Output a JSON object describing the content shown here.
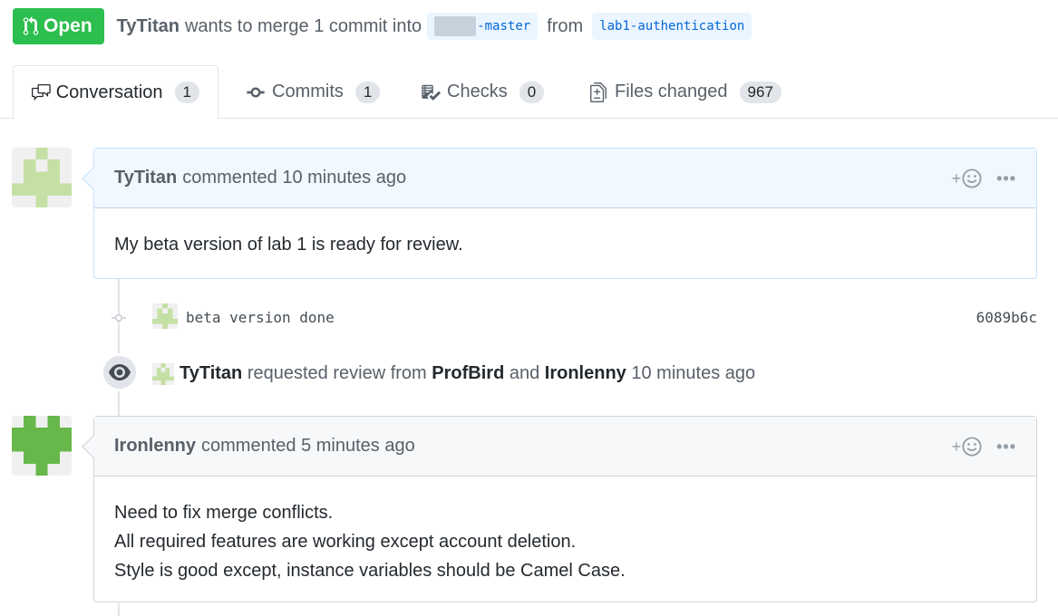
{
  "header": {
    "state_label": "Open",
    "author": "TyTitan",
    "summary": "wants to merge 1 commit into",
    "base_branch": "-master",
    "from_text": "from",
    "head_branch": "lab1-authentication"
  },
  "tabs": [
    {
      "label": "Conversation",
      "count": "1",
      "icon": "comment-discussion-icon"
    },
    {
      "label": "Commits",
      "count": "1",
      "icon": "git-commit-icon"
    },
    {
      "label": "Checks",
      "count": "0",
      "icon": "checklist-icon"
    },
    {
      "label": "Files changed",
      "count": "967",
      "icon": "diff-icon"
    }
  ],
  "comments": [
    {
      "author": "TyTitan",
      "meta": "commented 10 minutes ago",
      "body": [
        "My beta version of lab 1 is ready for review."
      ],
      "reaction_label": "+",
      "more_label": "•••"
    },
    {
      "author": "Ironlenny",
      "meta": "commented 5 minutes ago",
      "body": [
        "Need to fix merge conflicts.",
        "All required features are working except account deletion.",
        "Style is good except, instance variables should be Camel Case."
      ],
      "reaction_label": "+",
      "more_label": "•••"
    }
  ],
  "commit": {
    "message": "beta version done",
    "sha": "6089b6c"
  },
  "review_event": {
    "actor": "TyTitan",
    "text1": "requested review from",
    "reviewer1": "ProfBird",
    "text2": "and",
    "reviewer2": "Ironlenny",
    "time": "10 minutes ago"
  },
  "colors": {
    "open_green": "#2cbe4e",
    "link_blue": "#0366d6",
    "avatar_light_green": "#c5e0a5",
    "avatar_green": "#67b84a"
  }
}
